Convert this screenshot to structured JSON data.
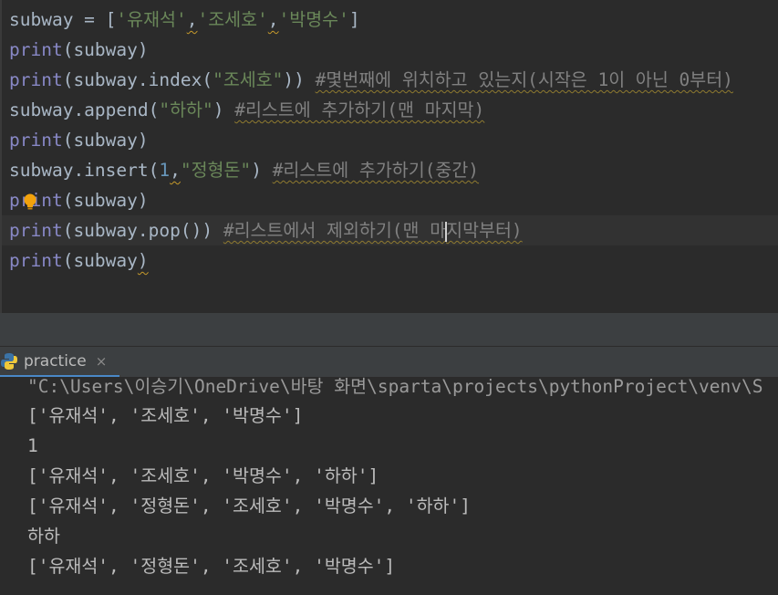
{
  "editor": {
    "line1": {
      "a": "subway = [",
      "s1": "'유재석'",
      "c1": ",",
      "s2": "'조세호'",
      "c2": ",",
      "s3": "'박명수'",
      "b": "]"
    },
    "line2": {
      "fn": "print",
      "rest": "(subway)"
    },
    "line3": {
      "fn": "print",
      "a": "(subway.index(",
      "s": "\"조세호\"",
      "b": "))",
      "cmt": "#몇번째에 위치하고 있는지(시작은 1이 아닌 0부터)"
    },
    "line4": {
      "a": "subway.append(",
      "s": "\"하하\"",
      "b": ")",
      "cmt": "#리스트에 추가하기(맨 마지막)"
    },
    "line5": {
      "fn": "print",
      "rest": "(subway)"
    },
    "line6": {
      "a": "subway.insert(",
      "n": "1",
      "c": ",",
      "s": "\"정형돈\"",
      "b": ")",
      "cmt": "#리스트에 추가하기(중간)"
    },
    "line7": {
      "fn": "print",
      "rest": "(subway)"
    },
    "line8": {
      "fn": "print",
      "a": "(subway.pop())",
      "cmt1": "#리스트에서 제외하기(맨 마",
      "cmt2": "지막부터)"
    },
    "line9": {
      "fn": "print",
      "a": "(subway",
      ")": ")"
    }
  },
  "run_panel": {
    "tab_label": "practice",
    "tab_close": "×",
    "path_line": "\"C:\\Users\\이승기\\OneDrive\\바탕 화면\\sparta\\projects\\pythonProject\\venv\\S",
    "outputs": [
      "['유재석', '조세호', '박명수']",
      "1",
      "['유재석', '조세호', '박명수', '하하']",
      "['유재석', '정형돈', '조세호', '박명수', '하하']",
      "하하",
      "['유재석', '정형돈', '조세호', '박명수']"
    ]
  },
  "icons": {
    "bulb": "lightbulb-icon",
    "python": "python-icon",
    "close": "close-icon"
  },
  "colors": {
    "keyword": "#8888c6",
    "string": "#6a8759",
    "number": "#6897bb",
    "comment": "#808080",
    "bulb": "#f2a20c"
  }
}
